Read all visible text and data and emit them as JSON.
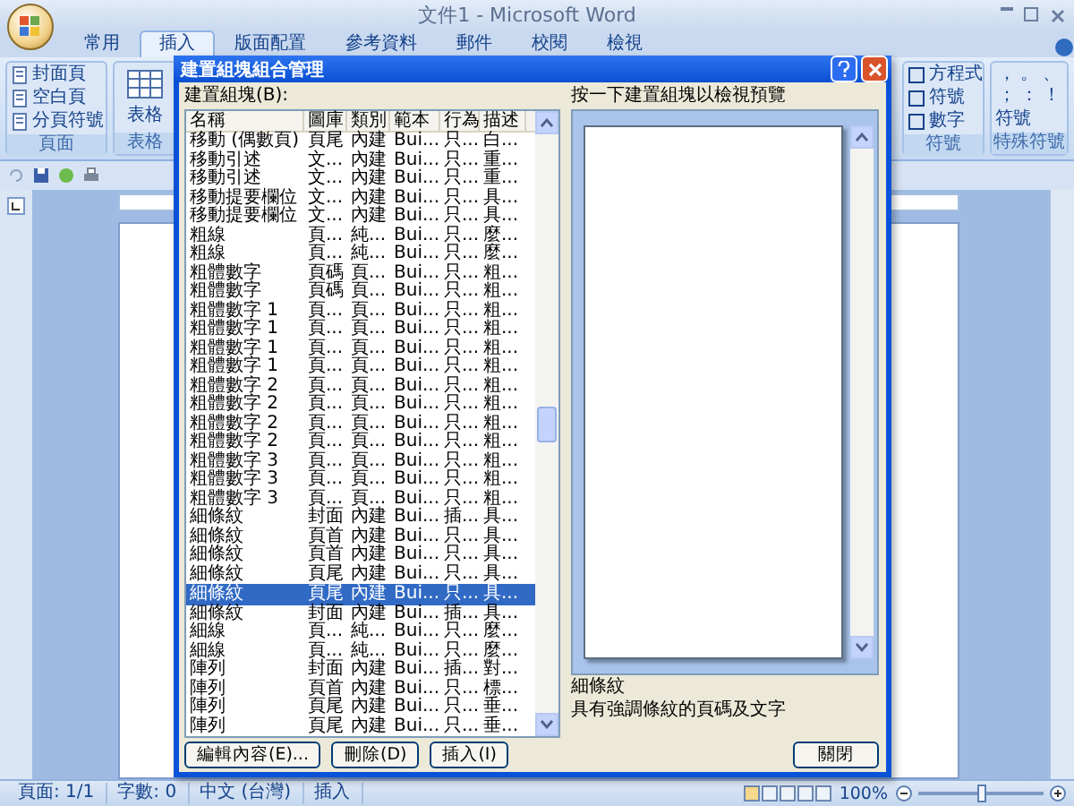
{
  "app_title": "文件1 - Microsoft Word",
  "tabs": [
    {
      "label": "常用",
      "selected": false
    },
    {
      "label": "插入",
      "selected": true
    },
    {
      "label": "版面配置",
      "selected": false
    },
    {
      "label": "參考資料",
      "selected": false
    },
    {
      "label": "郵件",
      "selected": false
    },
    {
      "label": "校閱",
      "selected": false
    },
    {
      "label": "檢視",
      "selected": false
    }
  ],
  "ribbon": {
    "page_group": {
      "label": "頁面",
      "buttons": [
        "封面頁",
        "空白頁",
        "分頁符號"
      ]
    },
    "table_group": {
      "label": "表格",
      "button": "表格"
    },
    "symbols_group": {
      "label": "符號",
      "buttons": [
        "方程式",
        "符號",
        "數字"
      ]
    },
    "special_group": {
      "label": "特殊符號",
      "marks": [
        "，",
        "。",
        "、",
        "；",
        "：",
        "！"
      ],
      "button": "符號"
    }
  },
  "dialog": {
    "title": "建置組塊組合管理",
    "list_label": "建置組塊(B):",
    "columns": [
      "名稱",
      "圖庫",
      "類別",
      "範本",
      "行為",
      "描述"
    ],
    "rows": [
      {
        "cells": [
          "移動 (偶數頁)",
          "頁尾",
          "內建",
          "Bui...",
          "只...",
          "白..."
        ],
        "selected": false
      },
      {
        "cells": [
          "移動引述",
          "文...",
          "內建",
          "Bui...",
          "只...",
          "重..."
        ],
        "selected": false
      },
      {
        "cells": [
          "移動引述",
          "文...",
          "內建",
          "Bui...",
          "只...",
          "重..."
        ],
        "selected": false
      },
      {
        "cells": [
          "移動提要欄位",
          "文...",
          "內建",
          "Bui...",
          "只...",
          "具..."
        ],
        "selected": false
      },
      {
        "cells": [
          "移動提要欄位",
          "文...",
          "內建",
          "Bui...",
          "只...",
          "具..."
        ],
        "selected": false
      },
      {
        "cells": [
          "粗線",
          "頁...",
          "純...",
          "Bui...",
          "只...",
          "麼..."
        ],
        "selected": false
      },
      {
        "cells": [
          "粗線",
          "頁...",
          "純...",
          "Bui...",
          "只...",
          "麼..."
        ],
        "selected": false
      },
      {
        "cells": [
          "粗體數字",
          "頁碼",
          "頁...",
          "Bui...",
          "只...",
          "粗..."
        ],
        "selected": false
      },
      {
        "cells": [
          "粗體數字",
          "頁碼",
          "頁...",
          "Bui...",
          "只...",
          "粗..."
        ],
        "selected": false
      },
      {
        "cells": [
          "粗體數字 1",
          "頁...",
          "頁...",
          "Bui...",
          "只...",
          "粗..."
        ],
        "selected": false
      },
      {
        "cells": [
          "粗體數字 1",
          "頁...",
          "頁...",
          "Bui...",
          "只...",
          "粗..."
        ],
        "selected": false
      },
      {
        "cells": [
          "粗體數字 1",
          "頁...",
          "頁...",
          "Bui...",
          "只...",
          "粗..."
        ],
        "selected": false
      },
      {
        "cells": [
          "粗體數字 1",
          "頁...",
          "頁...",
          "Bui...",
          "只...",
          "粗..."
        ],
        "selected": false
      },
      {
        "cells": [
          "粗體數字 2",
          "頁...",
          "頁...",
          "Bui...",
          "只...",
          "粗..."
        ],
        "selected": false
      },
      {
        "cells": [
          "粗體數字 2",
          "頁...",
          "頁...",
          "Bui...",
          "只...",
          "粗..."
        ],
        "selected": false
      },
      {
        "cells": [
          "粗體數字 2",
          "頁...",
          "頁...",
          "Bui...",
          "只...",
          "粗..."
        ],
        "selected": false
      },
      {
        "cells": [
          "粗體數字 2",
          "頁...",
          "頁...",
          "Bui...",
          "只...",
          "粗..."
        ],
        "selected": false
      },
      {
        "cells": [
          "粗體數字 3",
          "頁...",
          "頁...",
          "Bui...",
          "只...",
          "粗..."
        ],
        "selected": false
      },
      {
        "cells": [
          "粗體數字 3",
          "頁...",
          "頁...",
          "Bui...",
          "只...",
          "粗..."
        ],
        "selected": false
      },
      {
        "cells": [
          "粗體數字 3",
          "頁...",
          "頁...",
          "Bui...",
          "只...",
          "粗..."
        ],
        "selected": false
      },
      {
        "cells": [
          "細條紋",
          "封面",
          "內建",
          "Bui...",
          "插...",
          "具..."
        ],
        "selected": false
      },
      {
        "cells": [
          "細條紋",
          "頁首",
          "內建",
          "Bui...",
          "只...",
          "具..."
        ],
        "selected": false
      },
      {
        "cells": [
          "細條紋",
          "頁首",
          "內建",
          "Bui...",
          "只...",
          "具..."
        ],
        "selected": false
      },
      {
        "cells": [
          "細條紋",
          "頁尾",
          "內建",
          "Bui...",
          "只...",
          "具..."
        ],
        "selected": false
      },
      {
        "cells": [
          "細條紋",
          "頁尾",
          "內建",
          "Bui...",
          "只...",
          "具..."
        ],
        "selected": true
      },
      {
        "cells": [
          "細條紋",
          "封面",
          "內建",
          "Bui...",
          "插...",
          "具..."
        ],
        "selected": false
      },
      {
        "cells": [
          "細線",
          "頁...",
          "純...",
          "Bui...",
          "只...",
          "麼..."
        ],
        "selected": false
      },
      {
        "cells": [
          "細線",
          "頁...",
          "純...",
          "Bui...",
          "只...",
          "麼..."
        ],
        "selected": false
      },
      {
        "cells": [
          "陣列",
          "封面",
          "內建",
          "Bui...",
          "插...",
          "對..."
        ],
        "selected": false
      },
      {
        "cells": [
          "陣列",
          "頁首",
          "內建",
          "Bui...",
          "只...",
          "標..."
        ],
        "selected": false
      },
      {
        "cells": [
          "陣列",
          "頁尾",
          "內建",
          "Bui...",
          "只...",
          "垂..."
        ],
        "selected": false
      },
      {
        "cells": [
          "陣列",
          "頁尾",
          "內建",
          "Bui...",
          "只...",
          "垂..."
        ],
        "selected": false
      }
    ],
    "buttons": [
      "編輯內容(E)...",
      "刪除(D)",
      "插入(I)"
    ],
    "preview_label": "按一下建置組塊以檢視預覽",
    "preview_name": "細條紋",
    "preview_description": "具有強調條紋的頁碼及文字",
    "close_button": "關閉"
  },
  "status_bar": {
    "items": [
      "頁面: 1/1",
      "字數: 0",
      "中文 (台灣)",
      "插入"
    ],
    "zoom": "100%",
    "zoom_slider": {
      "level": 0.5
    }
  }
}
